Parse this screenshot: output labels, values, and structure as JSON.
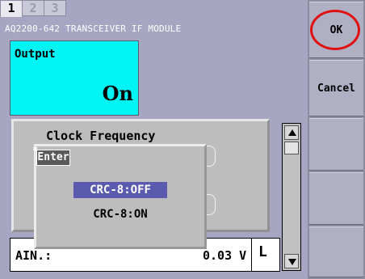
{
  "tabs": [
    "1",
    "2",
    "3"
  ],
  "module_title": "AQ2200-642 TRANSCEIVER IF MODULE",
  "output": {
    "label": "Output",
    "value": "On"
  },
  "clock": {
    "label": "Clock Frequency"
  },
  "status": {
    "left": "AIN.:",
    "value": "0.03 V",
    "unit": "L"
  },
  "enter_popup": {
    "marker": "*",
    "title": "Enter",
    "options": [
      "CRC-8:OFF",
      "CRC-8:ON"
    ],
    "selected": "CRC-8:OFF"
  },
  "softkeys": {
    "ok": "OK",
    "cancel": "Cancel"
  },
  "colors": {
    "output_bg": "#00f4f4",
    "selection": "#5a5aae",
    "highlight_ring": "#e01010"
  }
}
